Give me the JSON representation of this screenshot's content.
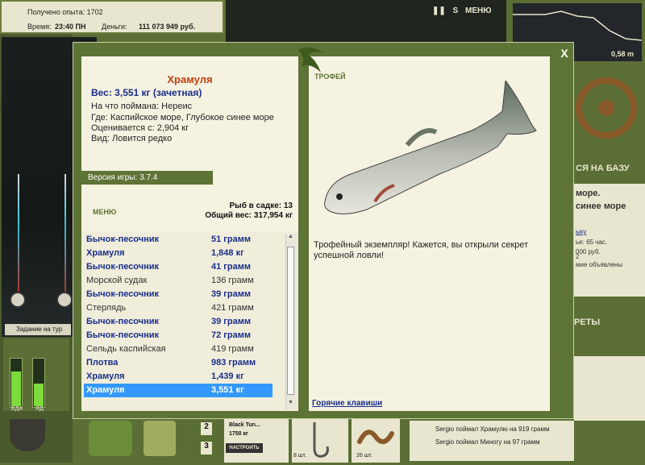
{
  "hud": {
    "exp_label": "Получено опыта: 1702",
    "time_label": "Время:",
    "time_value": "23:40 ПН",
    "money_label": "Деньги:",
    "money_value": "111 073 949 руб.",
    "menu_label": "МЕНЮ",
    "depth_value": "0,58 m",
    "task_label": "Задание на тур"
  },
  "gauges": {
    "left_label": "ЕДА",
    "right_label": "ЯД",
    "left_level": 0.72,
    "right_level": 0.46
  },
  "right_side": {
    "to_base": "СЯ НА БАЗУ",
    "location_1": "море.",
    "location_2": "синее море",
    "line_1": "ыку",
    "line_2": "ье: 65 час.",
    "line_3": "000 руб.",
    "line_4": "2",
    "line_5": "мие объявлены",
    "secrets": "РЕТЫ"
  },
  "bottom": {
    "slot_2": "2",
    "slot_3": "3",
    "tackle_name": "Black Tun...",
    "tackle_weight": "1750 кг",
    "setup_button": "НАСТРОИТЬ",
    "hook_qty": "8 шт.",
    "bait_qty": "26 шт.",
    "feed": [
      "Sergio поймал Храмулю на 919 грамм",
      "Sergio поймал Миногу на 97 грамм"
    ]
  },
  "modal": {
    "close": "X",
    "fish_name": "Храмуля",
    "fish_weight": "Вес: 3,551 кг (зачетная)",
    "caught_on": "На что поймана: Нереис",
    "where": "Где: Каспийское море, Глубокое синее море",
    "valued_from": "Оценивается с: 2,904 кг",
    "kind": "Вид: Ловится редко",
    "version": "Версия игры: 3.7.4",
    "menu": "МЕНЮ",
    "keep_count": "Рыб в садке: 13",
    "total_weight": "Общий вес: 317,954 кг",
    "trophy_label": "ТРОФЕЙ",
    "trophy_text": "Трофейный экземпляр! Кажется, вы открыли секрет успешной ловли!",
    "hotkeys": "Горячие клавиши",
    "catches": [
      {
        "name": "Бычок-песочник",
        "weight": "51 грамм",
        "style": "bold"
      },
      {
        "name": "Храмуля",
        "weight": "1,848 кг",
        "style": "bold"
      },
      {
        "name": "Бычок-песочник",
        "weight": "41 грамм",
        "style": "bold"
      },
      {
        "name": "Морской судак",
        "weight": "136 грамм",
        "style": "plain"
      },
      {
        "name": "Бычок-песочник",
        "weight": "39 грамм",
        "style": "bold"
      },
      {
        "name": "Стерлядь",
        "weight": "421 грамм",
        "style": "plain"
      },
      {
        "name": "Бычок-песочник",
        "weight": "39 грамм",
        "style": "bold"
      },
      {
        "name": "Бычок-песочник",
        "weight": "72 грамм",
        "style": "bold"
      },
      {
        "name": "Сельдь каспийская",
        "weight": "419 грамм",
        "style": "plain"
      },
      {
        "name": "Плотва",
        "weight": "983 грамм",
        "style": "bold"
      },
      {
        "name": "Храмуля",
        "weight": "1,439 кг",
        "style": "bold"
      },
      {
        "name": "Храмуля",
        "weight": "3,551 кг",
        "style": "sel"
      }
    ]
  }
}
